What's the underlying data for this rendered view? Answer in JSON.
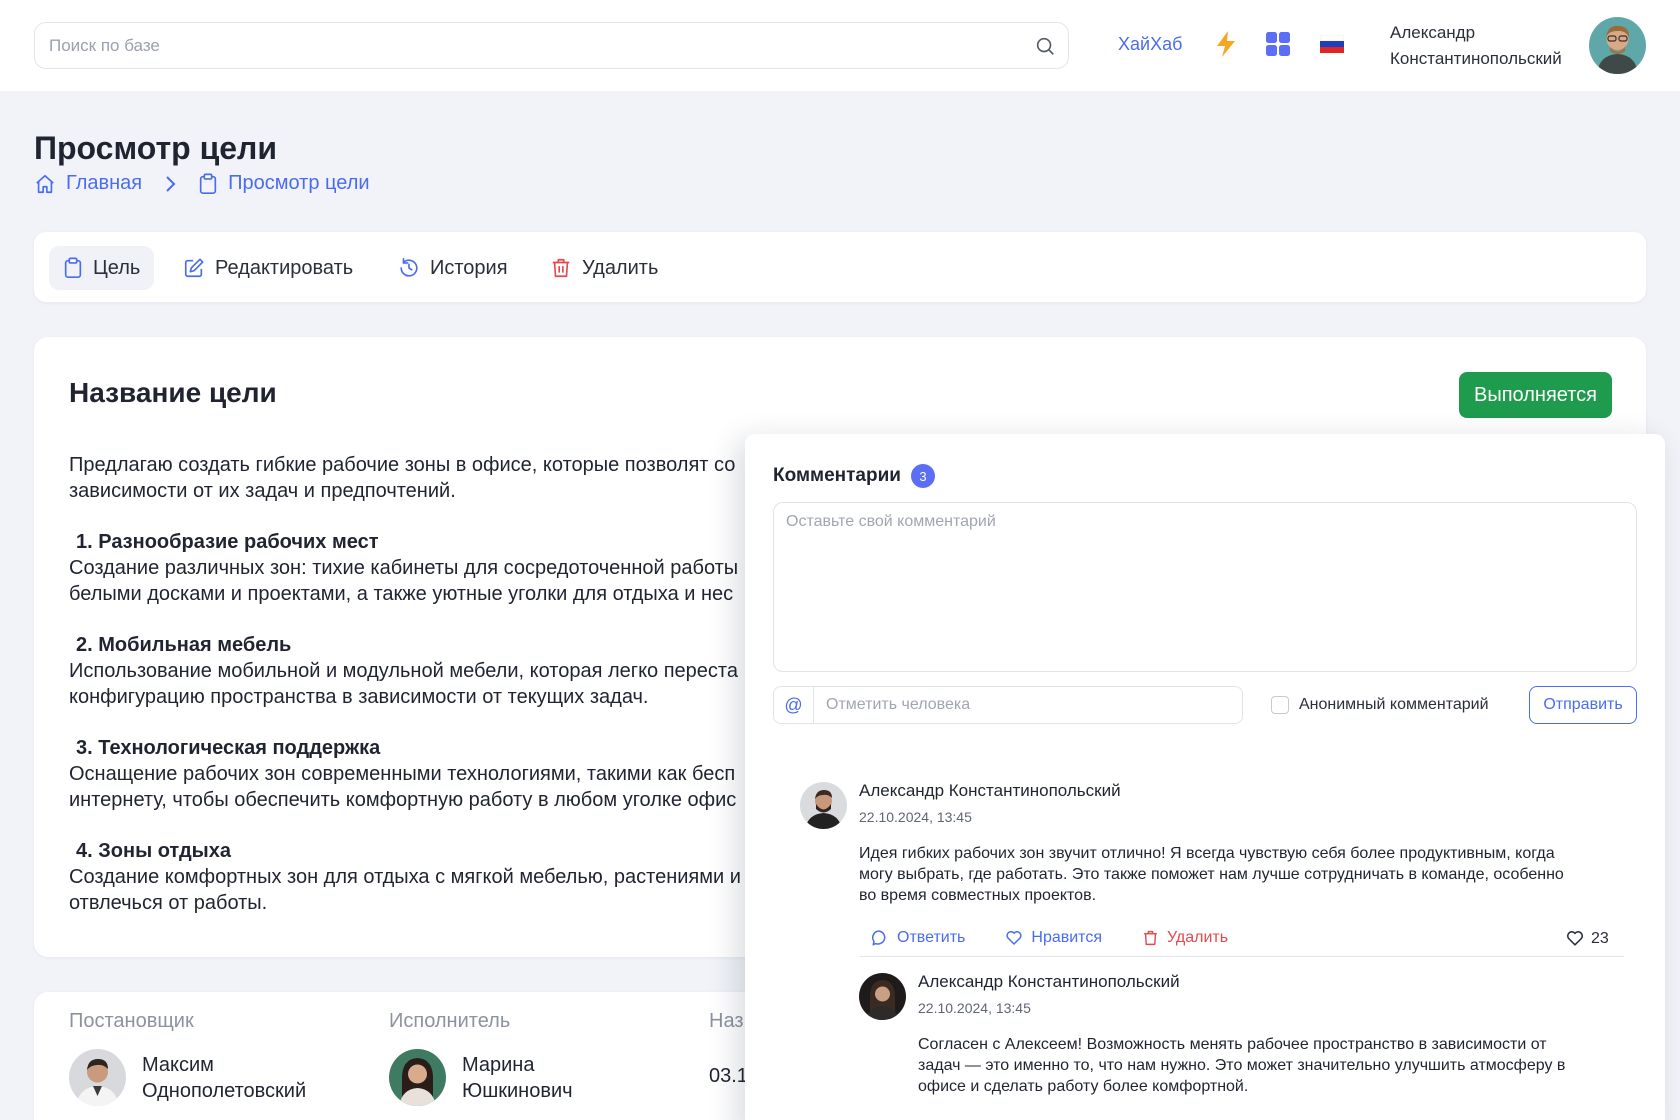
{
  "header": {
    "search_placeholder": "Поиск по базе",
    "hub_link": "ХайХаб",
    "user_name_line1": "Александр",
    "user_name_line2": "Константинопольский"
  },
  "page": {
    "title": "Просмотр цели",
    "breadcrumb": [
      {
        "label": "Главная",
        "icon": "home-icon"
      },
      {
        "label": "Просмотр цели",
        "icon": "clipboard-icon"
      }
    ]
  },
  "tabs": [
    {
      "label": "Цель",
      "icon": "clipboard-icon",
      "active": true
    },
    {
      "label": "Редактировать",
      "icon": "edit-icon"
    },
    {
      "label": "История",
      "icon": "history-icon"
    },
    {
      "label": "Удалить",
      "icon": "trash-icon"
    }
  ],
  "goal": {
    "title": "Название цели",
    "status": "Выполняется",
    "intro_1": "Предлагаю создать гибкие рабочие зоны в офисе, которые позволят со",
    "intro_2": "зависимости от их задач и предпочтений.",
    "sections": [
      {
        "title": "1. Разнообразие рабочих мест",
        "line1": "Создание различных зон: тихие кабинеты для сосредоточенной работы",
        "line2": "белыми досками и проектами, а также уютные уголки для отдыха и нес"
      },
      {
        "title": "2. Мобильная мебель",
        "line1": "Использование мобильной и модульной мебели, которая легко переста",
        "line2": "конфигурацию пространства в зависимости от текущих задач."
      },
      {
        "title": "3. Технологическая поддержка",
        "line1": "Оснащение рабочих зон современными технологиями, такими как бесп",
        "line2": "интернету, чтобы обеспечить комфортную работу в любом уголке офис"
      },
      {
        "title": "4. Зоны отдыха",
        "line1": "Создание комфортных зон для отдыха с мягкой мебелью, растениями и",
        "line2": "отвлечься от работы."
      }
    ]
  },
  "people": {
    "setter_label": "Постановщик",
    "setter_name_1": "Максим",
    "setter_name_2": "Однополетовский",
    "executor_label": "Исполнитель",
    "executor_name_1": "Марина",
    "executor_name_2": "Юшкинович",
    "date_label": "Наз",
    "date_value": "03.1"
  },
  "comments": {
    "title": "Комментарии",
    "count": "3",
    "textarea_placeholder": "Оставьте свой комментарий",
    "mention_placeholder": "Отметить человека",
    "mention_symbol": "@",
    "anonymous_label": "Анонимный комментарий",
    "send_label": "Отправить",
    "items": [
      {
        "author": "Александр Константинопольский",
        "date": "22.10.2024, 13:45",
        "line1": "Идея гибких рабочих зон звучит отлично! Я всегда чувствую себя более продуктивным, когда",
        "line2": "могу выбрать, где работать. Это также поможет нам лучше сотрудничать в команде, особенно",
        "line3": "во время совместных проектов.",
        "reply_label": "Ответить",
        "like_label": "Нравится",
        "delete_label": "Удалить",
        "likes": "23"
      },
      {
        "author": "Александр Константинопольский",
        "date": "22.10.2024, 13:45",
        "line1": "Согласен с Алексеем! Возможность менять рабочее пространство в зависимости от",
        "line2": "задач — это именно то, что нам нужно. Это может значительно улучшить атмосферу в",
        "line3": "офисе и сделать работу более комфортной."
      }
    ]
  },
  "colors": {
    "accent": "#4a6cf0",
    "status_green": "#1f9b4d",
    "danger": "#e5484d",
    "badge": "#5b6ef5"
  }
}
